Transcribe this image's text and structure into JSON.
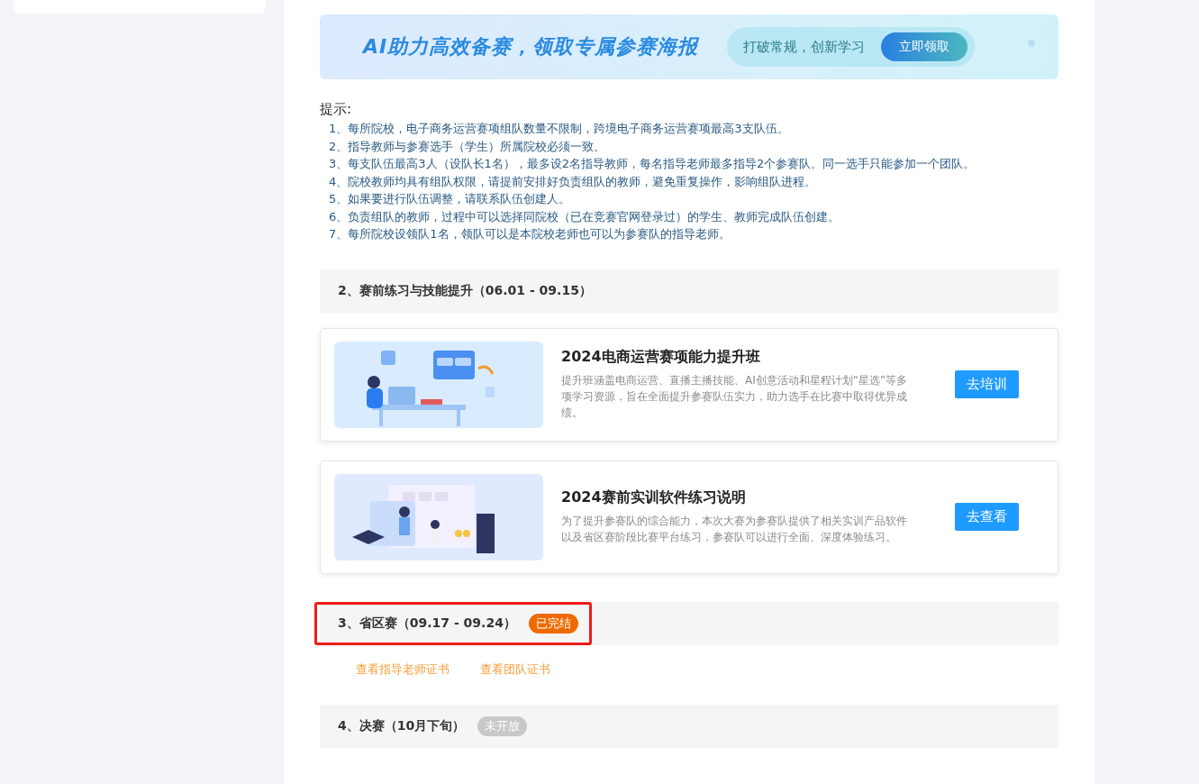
{
  "banner": {
    "headline": "AI助力高效备赛，领取专属参赛海报",
    "tagline": "打破常规，创新学习",
    "button": "立即领取"
  },
  "tips": {
    "title": "提示:",
    "items": [
      "1、每所院校，电子商务运营赛项组队数量不限制，跨境电子商务运营赛项最高3支队伍。",
      "2、指导教师与参赛选手（学生）所属院校必须一致。",
      "3、每支队伍最高3人（设队长1名），最多设2名指导教师，每名指导老师最多指导2个参赛队。同一选手只能参加一个团队。",
      "4、院校教师均具有组队权限，请提前安排好负责组队的教师，避免重复操作，影响组队进程。",
      "5、如果要进行队伍调整，请联系队伍创建人。",
      "6、负责组队的教师，过程中可以选择同院校（已在竞赛官网登录过）的学生、教师完成队伍创建。",
      "7、每所院校设领队1名，领队可以是本院校老师也可以为参赛队的指导老师。"
    ]
  },
  "sections": [
    {
      "title": "2、赛前练习与技能提升（06.01 - 09.15）",
      "highlighted": false,
      "cards": [
        {
          "kind": "desk",
          "title": "2024电商运营赛项能力提升班",
          "description": "提升班涵盖电商运营、直播主播技能、AI创意活动和星程计划“星选”等多项学习资源，旨在全面提升参赛队伍实力，助力选手在比赛中取得优异成绩。",
          "button": "去培训"
        },
        {
          "kind": "board",
          "title": "2024赛前实训软件练习说明",
          "description": "为了提升参赛队的综合能力，本次大赛为参赛队提供了相关实训产品软件以及省区赛阶段比赛平台练习，参赛队可以进行全面、深度体验练习。",
          "button": "去查看"
        }
      ]
    },
    {
      "title": "3、省区赛（09.17 - 09.24）",
      "highlighted": true,
      "status": {
        "kind": "finished",
        "label": "已完结"
      },
      "links": [
        "查看指导老师证书",
        "查看团队证书"
      ]
    },
    {
      "title": "4、决赛（10月下旬）",
      "highlighted": false,
      "status": {
        "kind": "unopened",
        "label": "未开放"
      }
    }
  ]
}
